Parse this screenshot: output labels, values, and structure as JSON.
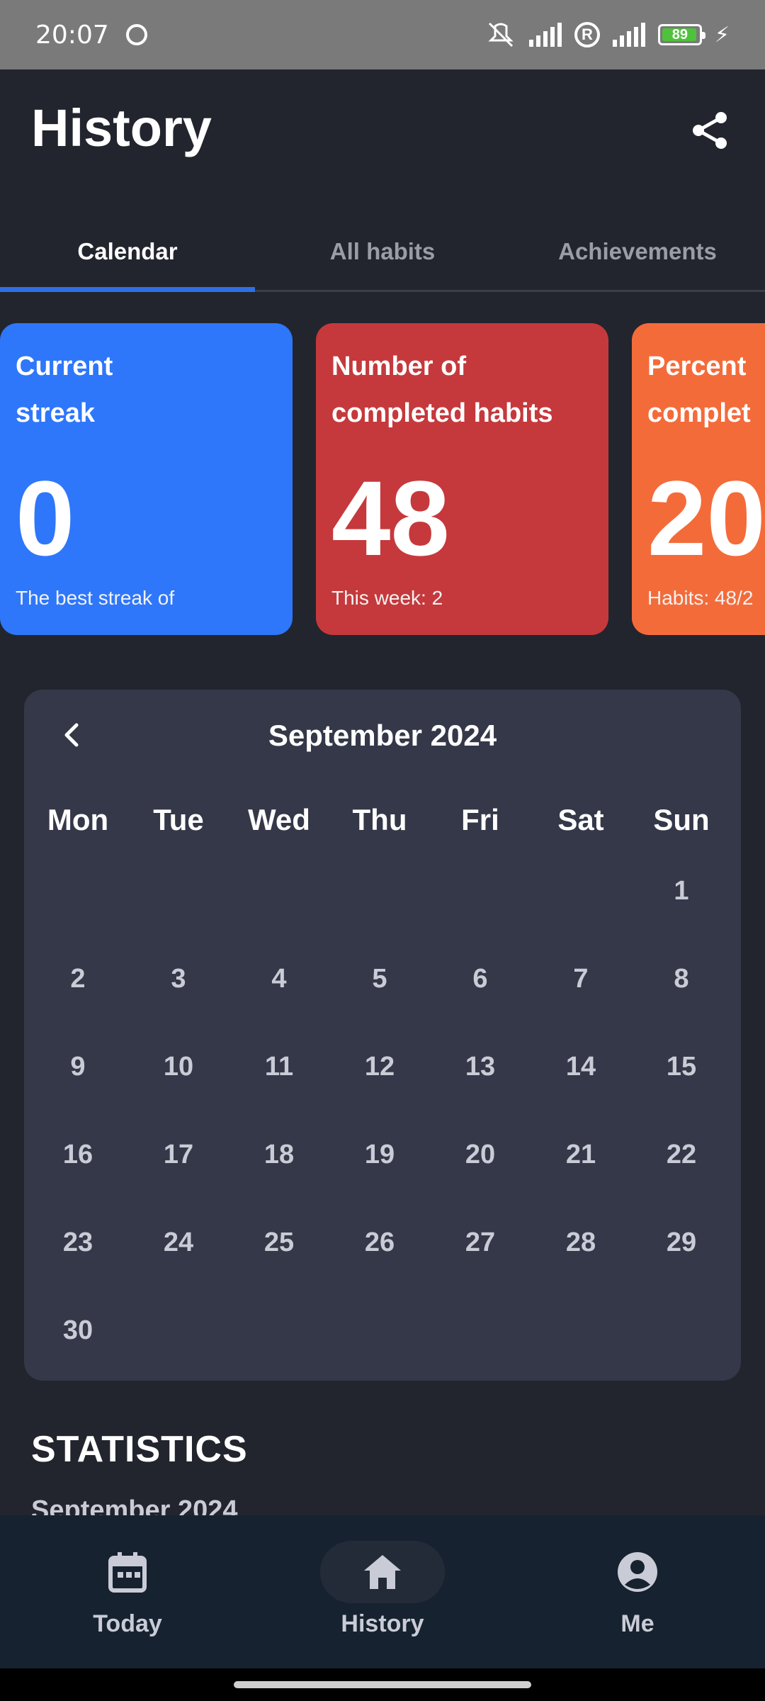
{
  "status_bar": {
    "time": "20:07",
    "battery": "89"
  },
  "header": {
    "title": "History"
  },
  "tabs": [
    {
      "label": "Calendar",
      "active": true
    },
    {
      "label": "All habits",
      "active": false
    },
    {
      "label": "Achievements",
      "active": false
    }
  ],
  "cards": [
    {
      "label_line1": "Current",
      "label_line2": "streak",
      "value": "0",
      "sub": "The best streak of",
      "color": "#2e77fa"
    },
    {
      "label_line1": "Number of",
      "label_line2": "completed habits",
      "value": "48",
      "sub": "This week: 2",
      "color": "#c5393c"
    },
    {
      "label_line1": "Percent",
      "label_line2": "complet",
      "value": "20",
      "sub": "Habits: 48/2",
      "color": "#f46b3a"
    }
  ],
  "calendar": {
    "month": "September 2024",
    "weekdays": [
      "Mon",
      "Tue",
      "Wed",
      "Thu",
      "Fri",
      "Sat",
      "Sun"
    ],
    "weeks": [
      [
        "",
        "",
        "",
        "",
        "",
        "",
        "1"
      ],
      [
        "2",
        "3",
        "4",
        "5",
        "6",
        "7",
        "8"
      ],
      [
        "9",
        "10",
        "11",
        "12",
        "13",
        "14",
        "15"
      ],
      [
        "16",
        "17",
        "18",
        "19",
        "20",
        "21",
        "22"
      ],
      [
        "23",
        "24",
        "25",
        "26",
        "27",
        "28",
        "29"
      ],
      [
        "30",
        "",
        "",
        "",
        "",
        "",
        ""
      ]
    ]
  },
  "statistics": {
    "title": "STATISTICS",
    "subtitle": "September 2024"
  },
  "bottom_nav": [
    {
      "label": "Today",
      "icon": "calendar-icon",
      "active": false
    },
    {
      "label": "History",
      "icon": "home-icon",
      "active": true
    },
    {
      "label": "Me",
      "icon": "account-icon",
      "active": false
    }
  ],
  "colors": {
    "background": "#22252e",
    "accent": "#2f6fe4",
    "calendar_bg": "#343848",
    "nav_bg": "#172230"
  }
}
